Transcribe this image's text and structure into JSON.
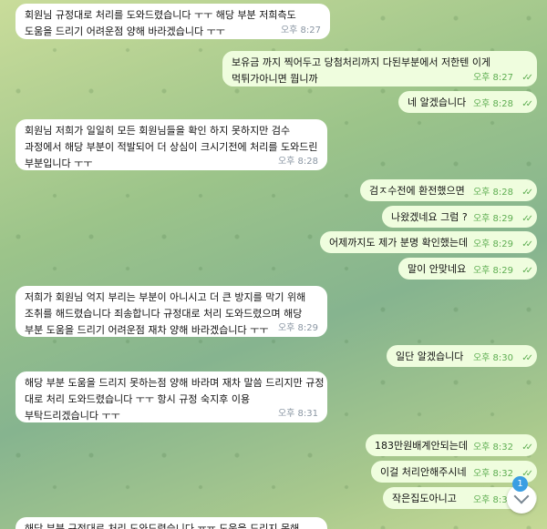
{
  "messages": [
    {
      "dir": "in",
      "text": "회원님 규정대로 처리를 도와드렸습니다 ㅜㅜ 해당 부분 저희측도\n도움을 드리기 어려운점 양해 바라겠습니다 ㅜㅜ",
      "time": "오후 8:27"
    },
    {
      "dir": "out",
      "text": "보유금 까지 찍어두고 당첨처리까지 다된부분에서 저한텐 이게\n먹튀가아니면 뭡니까",
      "time": "오후 8:27"
    },
    {
      "dir": "out",
      "text": "네 알겠습니다",
      "time": "오후 8:28"
    },
    {
      "dir": "in",
      "text": "회원님 저희가 일일히 모든 회원님들을 확인 하지 못하지만 검수\n과정에서 해당 부분이 적발되어 더 상심이 크시기전에 처리를 도와드린\n부분입니다 ㅜㅜ",
      "time": "오후 8:28"
    },
    {
      "dir": "out",
      "text": "검ㅈ수전에 환전했으면",
      "time": "오후 8:28"
    },
    {
      "dir": "out",
      "text": "나왔겠네요 그럼 ?",
      "time": "오후 8:29"
    },
    {
      "dir": "out",
      "text": "어제까지도 제가 분명 확인했는데",
      "time": "오후 8:29"
    },
    {
      "dir": "out",
      "text": "말이 안맞네요",
      "time": "오후 8:29"
    },
    {
      "dir": "in",
      "text": "저희가 회원님 억지 부리는 부분이 아니시고 더 큰 방지를 막기 위해\n조취를 해드렸습니다 죄송합니다 규정대로 처리 도와드렸으며 해당\n부분 도움을 드리기 어려운점 재차 양해 바라겠습니다 ㅜㅜ",
      "time": "오후 8:29"
    },
    {
      "dir": "out",
      "text": "일단 알겠습니다",
      "time": "오후 8:30"
    },
    {
      "dir": "in",
      "text": "해당 부분 도움을 드리지 못하는점 양해 바라며 재차 말씀 드리지만 규정\n대로 처리 도와드렸습니다 ㅜㅜ 항시 규정 숙지후 이용\n부탁드리겠습니다 ㅜㅜ",
      "time": "오후 8:31"
    },
    {
      "dir": "out",
      "text": "183만원배계안되는데",
      "time": "오후 8:32"
    },
    {
      "dir": "out",
      "text": "이걸 처리안해주시네",
      "time": "오후 8:32"
    },
    {
      "dir": "out",
      "text": "작은집도아니고",
      "time": "오후 8:32"
    },
    {
      "dir": "in",
      "text": "해당 부분 규정대로 처리 도와드렸습니다 ㅠㅠ 도움을 드리지 못해",
      "time": ""
    }
  ],
  "scroll_button": {
    "unread_count": "1",
    "icon": "chevron-down-icon"
  }
}
